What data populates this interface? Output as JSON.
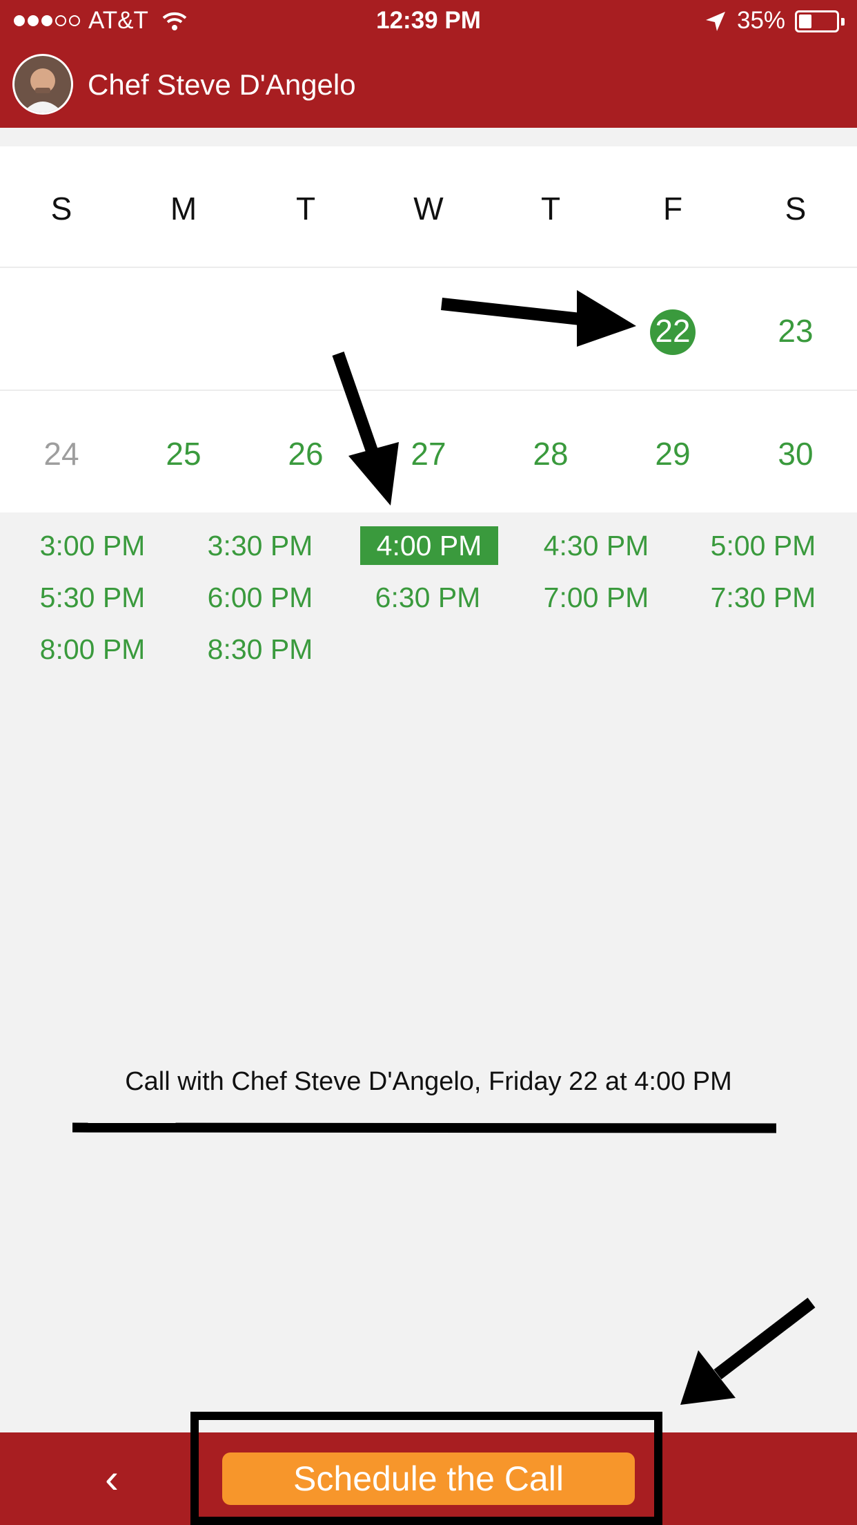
{
  "status_bar": {
    "carrier": "AT&T",
    "time": "12:39 PM",
    "battery_percent": "35%",
    "battery_level": 0.35
  },
  "header": {
    "title": "Chef Steve D'Angelo"
  },
  "calendar": {
    "weekdays": [
      "S",
      "M",
      "T",
      "W",
      "T",
      "F",
      "S"
    ],
    "week1": [
      "22",
      "23"
    ],
    "week2": [
      "24",
      "25",
      "26",
      "27",
      "28",
      "29",
      "30"
    ],
    "selected_day": "22",
    "disabled_days": [
      "24"
    ]
  },
  "time_slots": {
    "slots": [
      "3:00 PM",
      "3:30 PM",
      "4:00 PM",
      "4:30 PM",
      "5:00 PM",
      "5:30 PM",
      "6:00 PM",
      "6:30 PM",
      "7:00 PM",
      "7:30 PM",
      "8:00 PM",
      "8:30 PM"
    ],
    "selected": "4:00 PM"
  },
  "summary": "Call with Chef Steve D'Angelo, Friday 22 at 4:00 PM",
  "bottom_bar": {
    "back_label": "‹",
    "schedule_label": "Schedule the Call"
  },
  "colors": {
    "header_red": "#a81e21",
    "accent_green": "#3a9a3d",
    "button_orange": "#f7962b"
  }
}
